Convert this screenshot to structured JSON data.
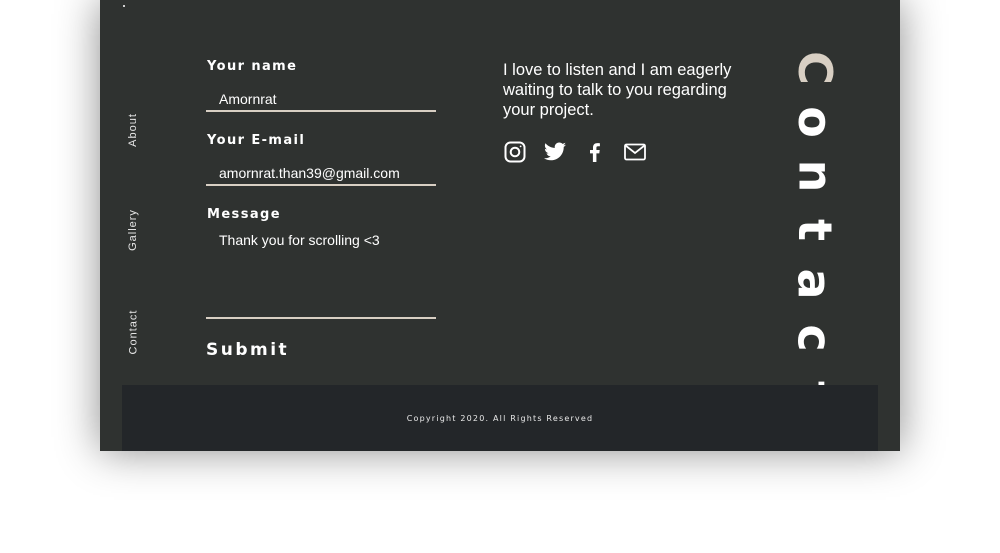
{
  "nav": {
    "items": [
      {
        "label": "About"
      },
      {
        "label": "Gallery"
      },
      {
        "label": "Contact"
      }
    ]
  },
  "form": {
    "name_label": "Your name",
    "name_value": "Amornrat",
    "email_label": "Your E-mail",
    "email_value": "amornrat.than39@gmail.com",
    "message_label": "Message",
    "message_value": "Thank you for scrolling <3",
    "submit_label": "Submit"
  },
  "intro": {
    "text": "I love to listen and I am eagerly waiting to talk to you regarding your project."
  },
  "socials": [
    {
      "icon": "instagram-icon"
    },
    {
      "icon": "twitter-icon"
    },
    {
      "icon": "facebook-icon"
    },
    {
      "icon": "mail-icon"
    }
  ],
  "heading": {
    "letters": [
      "C",
      "o",
      "n",
      "t",
      "a",
      "c",
      "t"
    ]
  },
  "footer": {
    "copyright": "Copyright 2020. All Rights Reserved"
  },
  "colors": {
    "background": "#2f3230",
    "footer": "#232629",
    "accent": "#d8cfc3",
    "text": "#ffffff"
  }
}
